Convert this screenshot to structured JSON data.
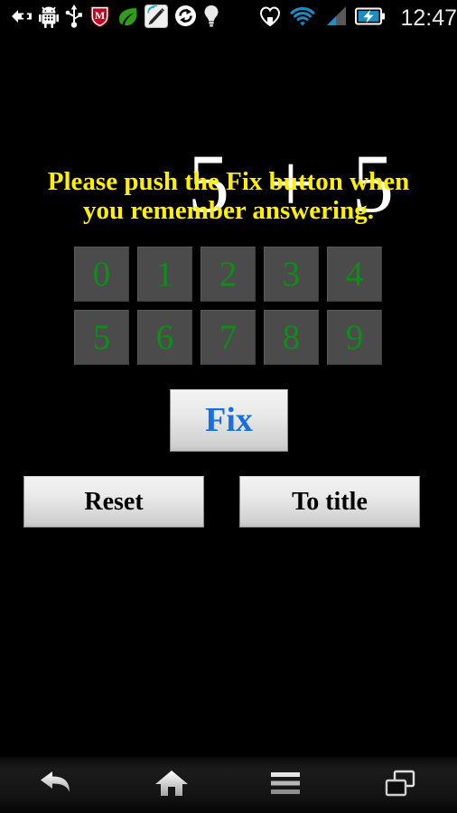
{
  "status_bar": {
    "clock": "12:47",
    "left_icons": [
      {
        "name": "download-plus-icon",
        "label": "plus-arrow"
      },
      {
        "name": "android-robot-icon",
        "label": "android"
      },
      {
        "name": "usb-icon",
        "label": "usb"
      },
      {
        "name": "mcafee-shield-icon",
        "label": "security-shield"
      },
      {
        "name": "leaf-icon",
        "label": "leaf"
      },
      {
        "name": "stylus-pen-icon",
        "label": "pen-signal"
      },
      {
        "name": "sync-icon",
        "label": "sync"
      },
      {
        "name": "lightbulb-icon",
        "label": "lightbulb"
      }
    ],
    "right_icons": [
      {
        "name": "heart-icon",
        "label": "heart"
      },
      {
        "name": "wifi-icon",
        "label": "wifi"
      },
      {
        "name": "signal-bars-icon",
        "label": "cellular-signal"
      },
      {
        "name": "battery-charging-icon",
        "label": "battery-charging"
      }
    ],
    "colors": {
      "wifi": "#1a8fc7",
      "signal_active": "#1a8fc7",
      "signal_inactive": "#555555",
      "battery": "#1a8fc7"
    }
  },
  "main": {
    "equation": {
      "left_operand": "5",
      "operator": "+",
      "right_operand": "5"
    },
    "instruction_line1": "Please push the Fix button when",
    "instruction_line2": "you remember answering.",
    "instruction_color": "#fff000",
    "keypad": {
      "rows": [
        [
          "0",
          "1",
          "2",
          "3",
          "4"
        ],
        [
          "5",
          "6",
          "7",
          "8",
          "9"
        ]
      ],
      "digit_color": "#0b8f16",
      "key_background": "#4b4b4b"
    },
    "fix_button": {
      "label": "Fix",
      "text_color": "#1a6fe0"
    },
    "reset_button": {
      "label": "Reset"
    },
    "to_title_button": {
      "label": "To title"
    }
  },
  "nav_bar": {
    "buttons": [
      {
        "name": "nav-back-button",
        "label": "Back"
      },
      {
        "name": "nav-home-button",
        "label": "Home"
      },
      {
        "name": "nav-menu-button",
        "label": "Menu"
      },
      {
        "name": "nav-recents-button",
        "label": "Recent apps"
      }
    ]
  }
}
